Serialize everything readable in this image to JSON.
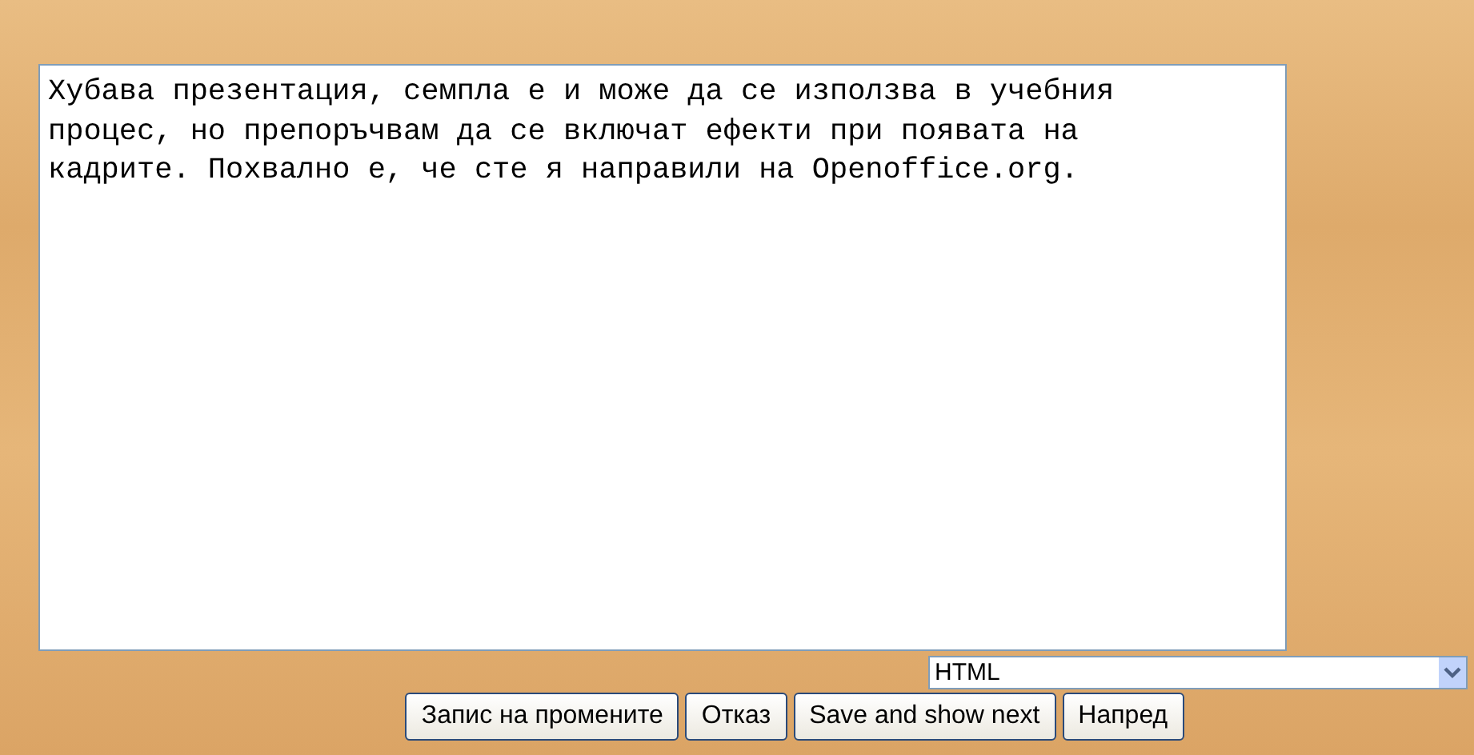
{
  "comment_box": {
    "value_lines": [
      "Хубава презентация, семпла е и може да се използва в учебния",
      "процес, но препоръчвам да се включат ефекти при появата на",
      "кадрите. Похвално е, че сте я направили на Openoffice.org."
    ]
  },
  "format_select": {
    "value": "HTML"
  },
  "buttons": [
    "Запис на промените",
    "Отказ",
    "Save and show next",
    "Напред"
  ]
}
